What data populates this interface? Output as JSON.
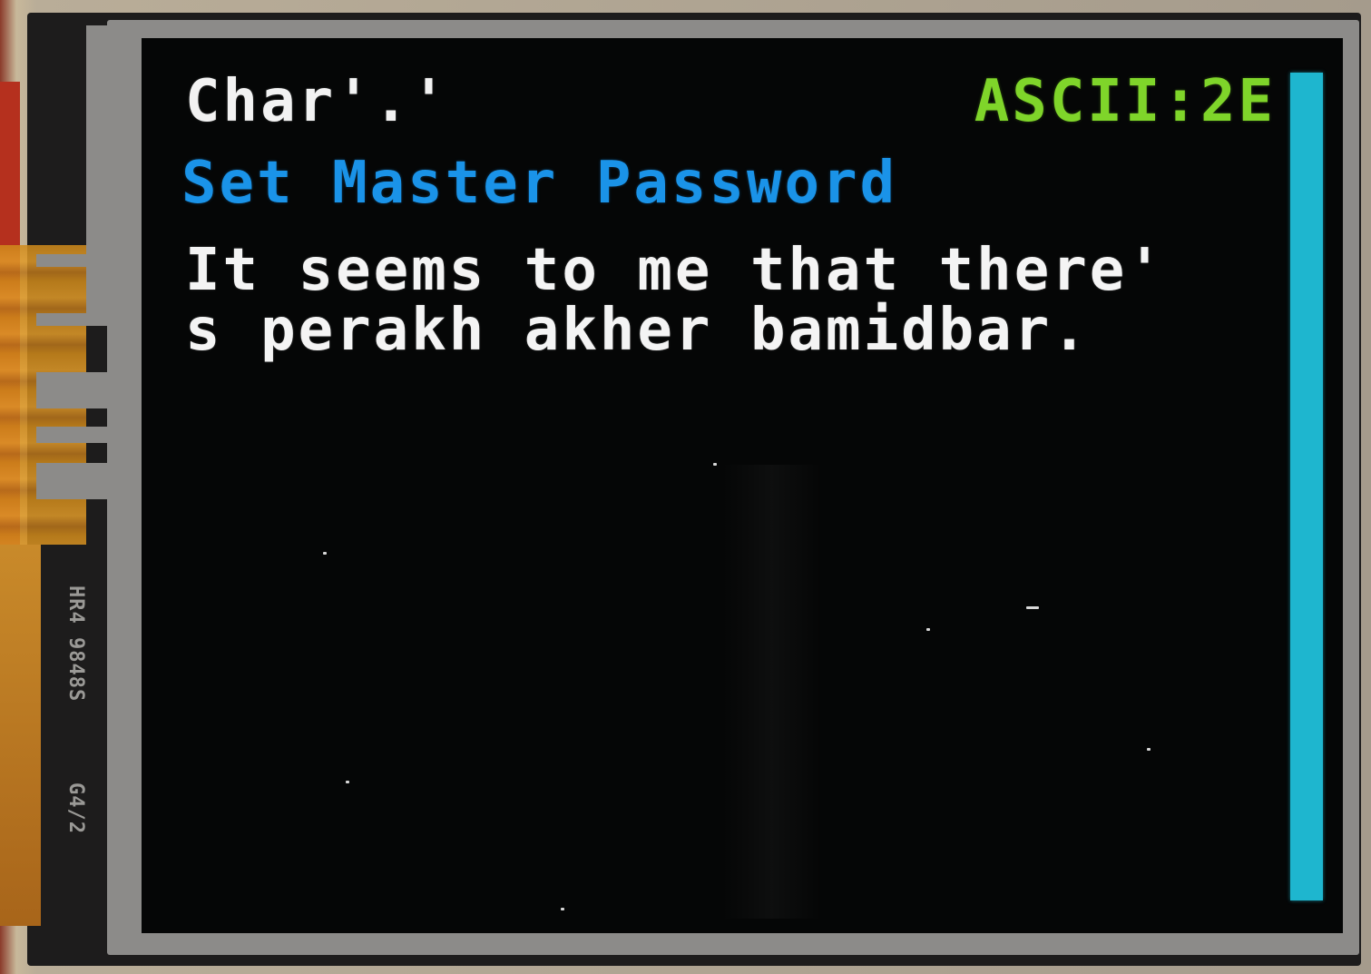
{
  "status_bar": {
    "char_text": "Char'.'",
    "ascii_text": "ASCII:2E"
  },
  "screen": {
    "title": "Set Master Password",
    "message_lines": [
      "It seems to me that there'",
      "s perakh akher bamidbar."
    ]
  },
  "scrollbar": {
    "color": "#1eb6cf",
    "position": 1.0
  },
  "board_markings": {
    "part_number": "HR4 9848S",
    "revision": "G4/2"
  },
  "colors": {
    "char_label": "#f2f2f2",
    "ascii_label": "#7fd52a",
    "title": "#1a93e8",
    "body": "#f4f4f4",
    "screen_bg": "#050606"
  }
}
